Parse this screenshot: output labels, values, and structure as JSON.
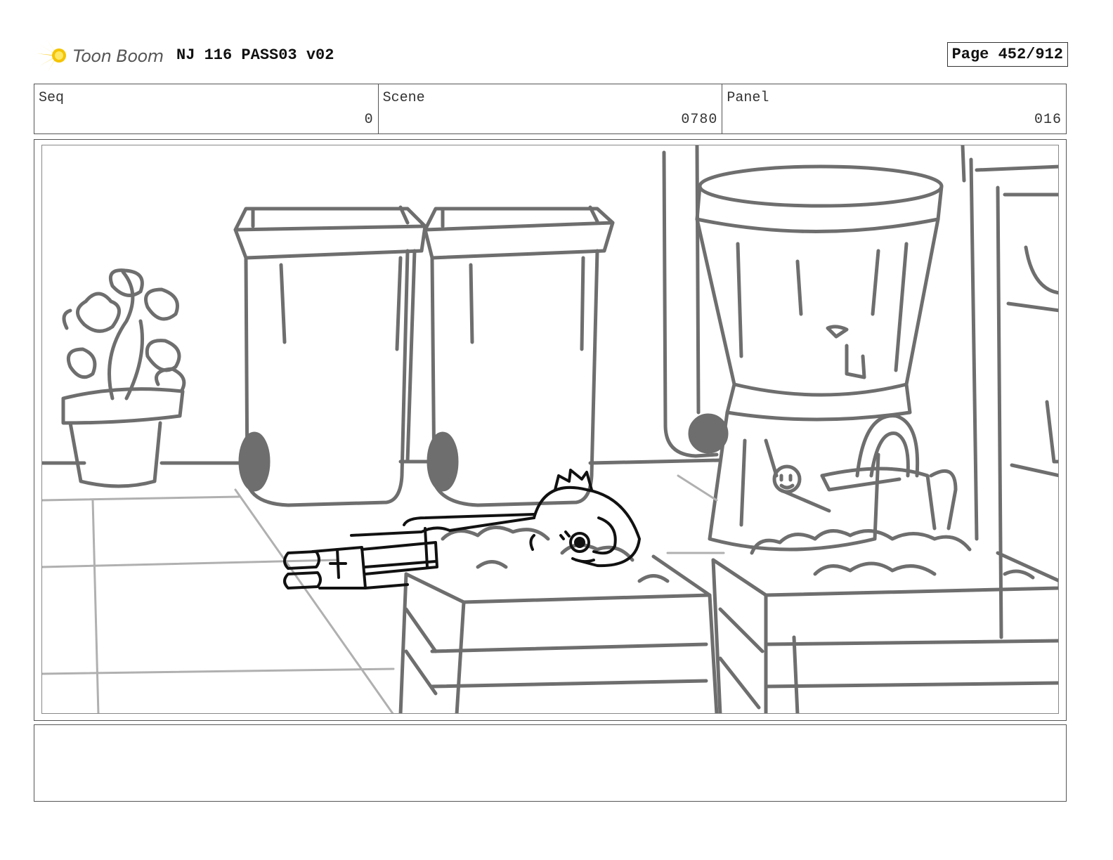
{
  "header": {
    "logo_text": "Toon Boom",
    "doc_title": "NJ 116 PASS03 v02",
    "page_label": "Page 452/912"
  },
  "info": {
    "seq": {
      "label": "Seq",
      "value": "0"
    },
    "scene": {
      "label": "Scene",
      "value": "0780"
    },
    "panel": {
      "label": "Panel",
      "value": "016"
    }
  },
  "panel_image": {
    "description_icons": [
      "potted-plant",
      "wheelie-bin",
      "wheelie-bin",
      "water-dispenser",
      "watering-can",
      "produce-crate",
      "produce-crate",
      "character-lying-down"
    ]
  },
  "notes": {
    "text": ""
  },
  "colors": {
    "sketch_gray": "#6e6e6e",
    "light_gray": "#b0b0b0",
    "ink": "#111111",
    "logo_yellow": "#f5c400"
  }
}
